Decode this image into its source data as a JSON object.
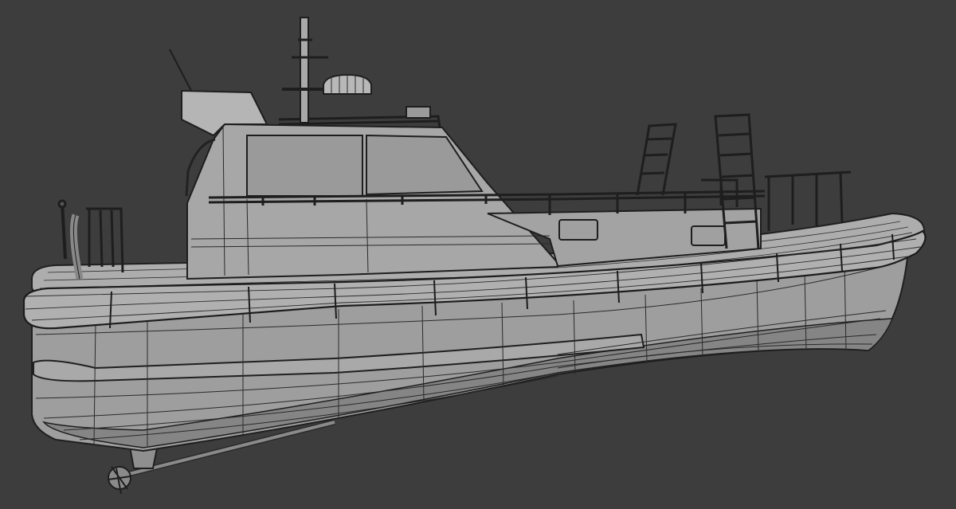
{
  "viewport": {
    "background": "#3d3d3d",
    "subject": "wireframe-boat-model",
    "colors": {
      "hull_fill": "#9d9d9d",
      "hull_shade": "#7c7c7c",
      "deck_fill": "#acacac",
      "cabin_fill": "#a6a6a6",
      "window_fill": "#9a9a9a",
      "wire": "#242424"
    }
  }
}
